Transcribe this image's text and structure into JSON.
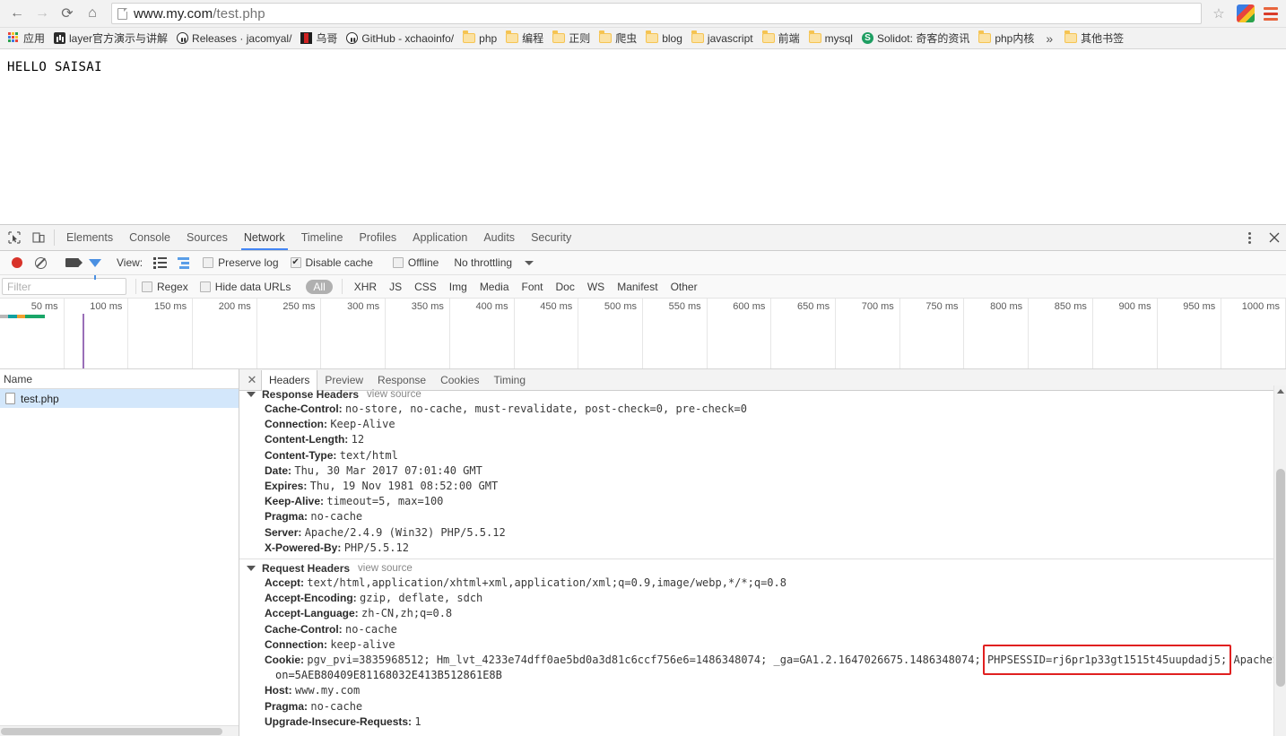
{
  "browser": {
    "nav": {
      "back": "←",
      "forward": "→",
      "reload": "⟳",
      "home": "⌂"
    },
    "url_main": "www.my.com",
    "url_path": "/test.php",
    "star_glyph": "☆",
    "bookmarks": [
      {
        "label": "应用",
        "icon": "apps-grid-icon"
      },
      {
        "label": "layer官方演示与讲解",
        "icon": "layer-icon"
      },
      {
        "label": "Releases · jacomyal/",
        "icon": "github-icon"
      },
      {
        "label": "乌哥",
        "icon": "wuge-icon"
      },
      {
        "label": "GitHub - xchaoinfo/",
        "icon": "github-icon"
      },
      {
        "label": "php",
        "icon": "folder-icon"
      },
      {
        "label": "编程",
        "icon": "folder-icon"
      },
      {
        "label": "正则",
        "icon": "folder-icon"
      },
      {
        "label": "爬虫",
        "icon": "folder-icon"
      },
      {
        "label": "blog",
        "icon": "folder-icon"
      },
      {
        "label": "javascript",
        "icon": "folder-icon"
      },
      {
        "label": "前端",
        "icon": "folder-icon"
      },
      {
        "label": "mysql",
        "icon": "folder-icon"
      },
      {
        "label": "Solidot: 奇客的资讯",
        "icon": "solidot-icon"
      },
      {
        "label": "php内核",
        "icon": "folder-icon"
      }
    ],
    "bookmark_overflow": "»",
    "other_bookmarks": {
      "label": "其他书签",
      "icon": "folder-icon"
    }
  },
  "page": {
    "body_text": "HELLO SAISAI"
  },
  "devtools": {
    "tabs": [
      {
        "label": "Elements",
        "active": false
      },
      {
        "label": "Console",
        "active": false
      },
      {
        "label": "Sources",
        "active": false
      },
      {
        "label": "Network",
        "active": true
      },
      {
        "label": "Timeline",
        "active": false
      },
      {
        "label": "Profiles",
        "active": false
      },
      {
        "label": "Application",
        "active": false
      },
      {
        "label": "Audits",
        "active": false
      },
      {
        "label": "Security",
        "active": false
      }
    ],
    "toolbar": {
      "record_title": "record-button",
      "clear_title": "clear-button",
      "view_label": "View:",
      "preserve_log": {
        "label": "Preserve log",
        "checked": false
      },
      "disable_cache": {
        "label": "Disable cache",
        "checked": true
      },
      "offline": {
        "label": "Offline",
        "checked": false
      },
      "throttling": "No throttling"
    },
    "filterbar": {
      "filter_placeholder": "Filter",
      "filter_value": "",
      "regex": {
        "label": "Regex",
        "checked": false
      },
      "hide_data_urls": {
        "label": "Hide data URLs",
        "checked": false
      },
      "types": [
        "All",
        "XHR",
        "JS",
        "CSS",
        "Img",
        "Media",
        "Font",
        "Doc",
        "WS",
        "Manifest",
        "Other"
      ],
      "active_type": "All"
    },
    "timeline": {
      "ticks": [
        "50 ms",
        "100 ms",
        "150 ms",
        "200 ms",
        "250 ms",
        "300 ms",
        "350 ms",
        "400 ms",
        "450 ms",
        "500 ms",
        "550 ms",
        "600 ms",
        "650 ms",
        "700 ms",
        "750 ms",
        "800 ms",
        "850 ms",
        "900 ms",
        "950 ms",
        "1000 ms"
      ],
      "waterfall_segments": [
        {
          "color": "#b8b8b8",
          "width": 9
        },
        {
          "color": "#11a0a0",
          "width": 10
        },
        {
          "color": "#f0a030",
          "width": 9
        },
        {
          "color": "#1aa668",
          "width": 22
        }
      ],
      "event_line_color": "#9a6fb8"
    },
    "requests": {
      "column_name": "Name",
      "rows": [
        {
          "name": "test.php",
          "selected": true
        }
      ]
    },
    "detail_tabs": [
      {
        "label": "Headers",
        "active": true
      },
      {
        "label": "Preview",
        "active": false
      },
      {
        "label": "Response",
        "active": false
      },
      {
        "label": "Cookies",
        "active": false
      },
      {
        "label": "Timing",
        "active": false
      }
    ],
    "headers": {
      "response_section": {
        "title": "Response Headers",
        "view_source": "view source",
        "items": [
          {
            "key": "Cache-Control:",
            "value": "no-store, no-cache, must-revalidate, post-check=0, pre-check=0"
          },
          {
            "key": "Connection:",
            "value": "Keep-Alive"
          },
          {
            "key": "Content-Length:",
            "value": "12"
          },
          {
            "key": "Content-Type:",
            "value": "text/html"
          },
          {
            "key": "Date:",
            "value": "Thu, 30 Mar 2017 07:01:40 GMT"
          },
          {
            "key": "Expires:",
            "value": "Thu, 19 Nov 1981 08:52:00 GMT"
          },
          {
            "key": "Keep-Alive:",
            "value": "timeout=5, max=100"
          },
          {
            "key": "Pragma:",
            "value": "no-cache"
          },
          {
            "key": "Server:",
            "value": "Apache/2.4.9 (Win32) PHP/5.5.12"
          },
          {
            "key": "X-Powered-By:",
            "value": "PHP/5.5.12"
          }
        ]
      },
      "request_section": {
        "title": "Request Headers",
        "view_source": "view source",
        "items_before_cookie": [
          {
            "key": "Accept:",
            "value": "text/html,application/xhtml+xml,application/xml;q=0.9,image/webp,*/*;q=0.8"
          },
          {
            "key": "Accept-Encoding:",
            "value": "gzip, deflate, sdch"
          },
          {
            "key": "Accept-Language:",
            "value": "zh-CN,zh;q=0.8"
          },
          {
            "key": "Cache-Control:",
            "value": "no-cache"
          },
          {
            "key": "Connection:",
            "value": "keep-alive"
          }
        ],
        "cookie": {
          "key": "Cookie:",
          "part1": "pgv_pvi=3835968512; Hm_lvt_4233e74dff0ae5bd0a3d81c6ccf756e6=1486348074; _ga=GA1.2.1647026675.1486348074; ",
          "highlighted": "PHPSESSID=rj6pr1p33gt1515t45uupdadj5;",
          "part2": " ApacheSafeDogLGSessi",
          "continuation": "on=5AEB80409E81168032E413B512861E8B"
        },
        "items_after_cookie": [
          {
            "key": "Host:",
            "value": "www.my.com"
          },
          {
            "key": "Pragma:",
            "value": "no-cache"
          },
          {
            "key": "Upgrade-Insecure-Requests:",
            "value": "1"
          }
        ]
      }
    },
    "highlight_color": "#e02020"
  }
}
